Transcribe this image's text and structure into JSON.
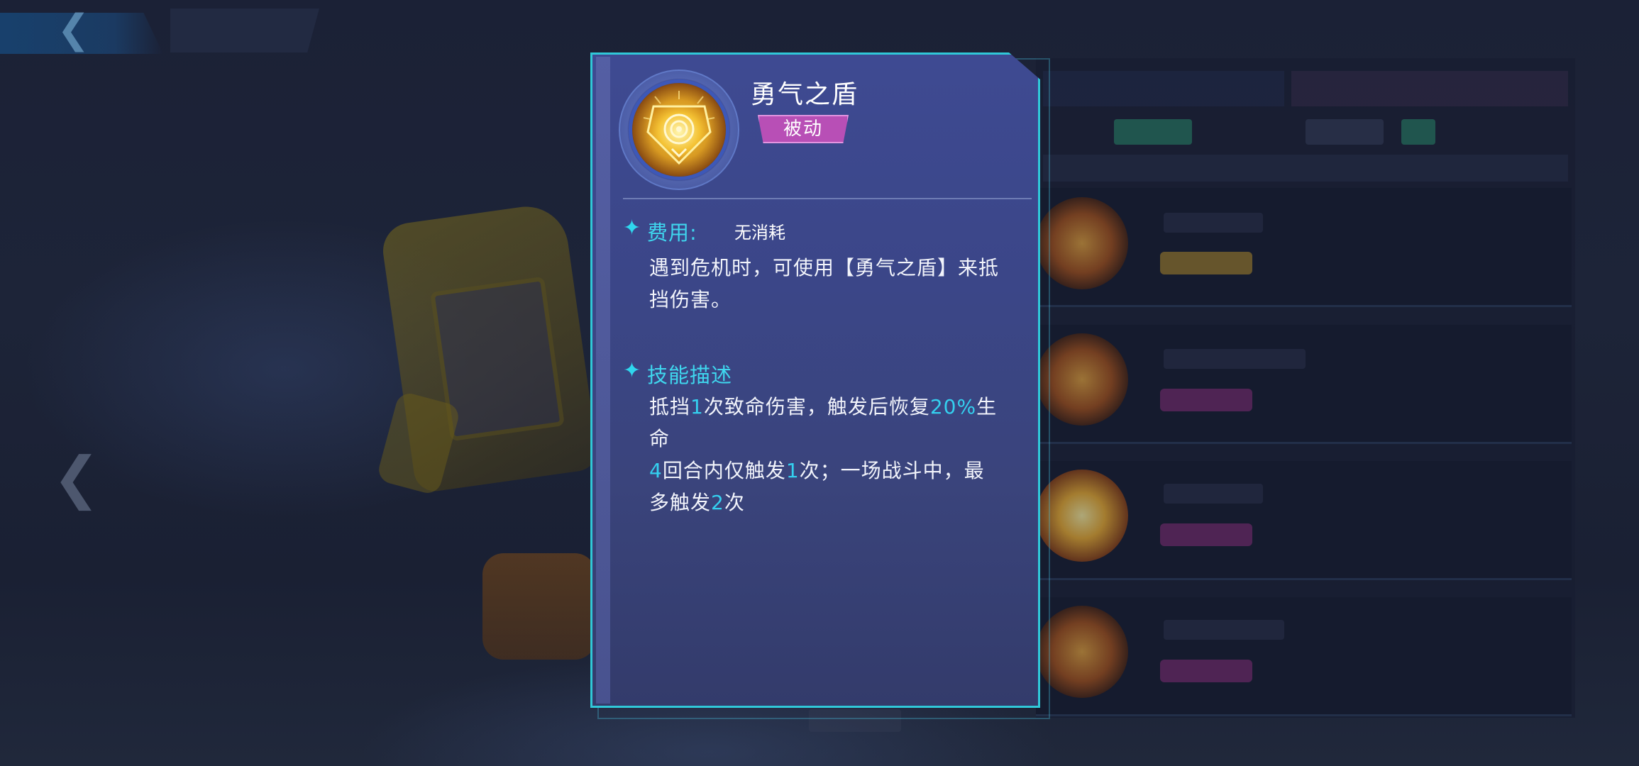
{
  "popup": {
    "skill_name": "勇气之盾",
    "skill_type": "被动",
    "cost_label": "费用:",
    "cost_value": "无消耗",
    "summary_line1": "遇到危机时，可使用【勇气之盾】来抵",
    "summary_line2": "挡伤害。",
    "description_label": "技能描述",
    "description_line1": [
      {
        "text": "抵挡",
        "highlight": false
      },
      {
        "text": "1",
        "highlight": true
      },
      {
        "text": "次致命伤害，触发后恢复",
        "highlight": false
      },
      {
        "text": "20%",
        "highlight": true
      },
      {
        "text": "生",
        "highlight": false
      }
    ],
    "description_line2": "命",
    "description_line3": [
      {
        "text": "4",
        "highlight": true
      },
      {
        "text": "回合内仅触发",
        "highlight": false
      },
      {
        "text": "1",
        "highlight": true
      },
      {
        "text": "次；一场战斗中，最",
        "highlight": false
      }
    ],
    "description_line4": [
      {
        "text": "多触发",
        "highlight": false
      },
      {
        "text": "2",
        "highlight": true
      },
      {
        "text": "次",
        "highlight": false
      }
    ]
  },
  "colors": {
    "accent_cyan": "#34d0ef",
    "card_border": "#30c8d8",
    "passive_tag": "#b84fb6",
    "card_bg": "#3e4a92"
  },
  "icons": {
    "back": "chevron-left-icon",
    "skill": "shield-icon",
    "section_marker": "sparkle-star-icon",
    "prev_character": "chevron-left-icon"
  }
}
